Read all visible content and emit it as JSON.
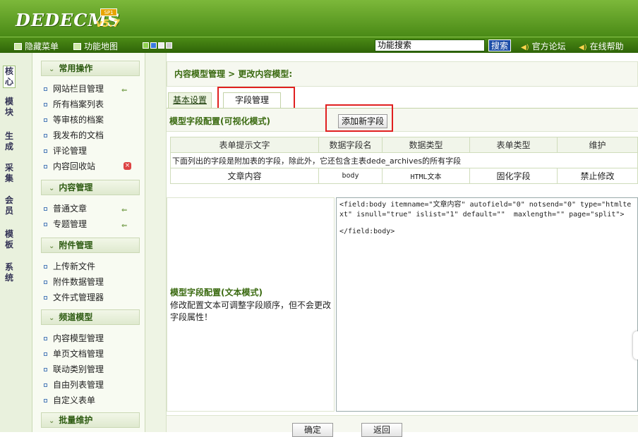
{
  "header": {
    "logo": "DEDECMS",
    "version": "v5.7",
    "badge": "SP1"
  },
  "toolbar": {
    "hide_menu": "隐藏菜单",
    "site_map": "功能地图",
    "search_value": "功能搜索",
    "search_button": "搜索",
    "forum": "官方论坛",
    "help": "在线帮助",
    "swatch_colors": [
      "#8fd14f",
      "#3a7ae0",
      "#eeeeee",
      "#cccccc"
    ]
  },
  "side_tabs": [
    "核心",
    "模块",
    "生成",
    "采集",
    "会员",
    "模板",
    "系统"
  ],
  "menu": {
    "groups": [
      {
        "title": "常用操作",
        "items": [
          "网站栏目管理",
          "所有档案列表",
          "等审核的档案",
          "我发布的文档",
          "评论管理",
          "内容回收站"
        ]
      },
      {
        "title": "内容管理",
        "items": [
          "普通文章",
          "专题管理"
        ]
      },
      {
        "title": "附件管理",
        "items": [
          "上传新文件",
          "附件数据管理",
          "文件式管理器"
        ]
      },
      {
        "title": "频道模型",
        "items": [
          "内容模型管理",
          "单页文档管理",
          "联动类别管理",
          "自由列表管理",
          "自定义表单"
        ]
      },
      {
        "title": "批量维护",
        "items": []
      }
    ]
  },
  "main": {
    "breadcrumb": "内容模型管理 > 更改内容模型:",
    "tabs": [
      "基本设置",
      "字段管理"
    ],
    "config_title": "模型字段配置(可视化模式)",
    "add_field_button": "添加新字段",
    "table": {
      "headers": [
        "表单提示文字",
        "数据字段名",
        "数据类型",
        "表单类型",
        "维护"
      ],
      "note": "下面列出的字段是附加表的字段，除此外，它还包含主表dede_archives的所有字段",
      "rows": [
        [
          "文章内容",
          "body",
          "HTML文本",
          "固化字段",
          "禁止修改"
        ]
      ]
    },
    "text_mode_title": "模型字段配置(文本模式)",
    "text_mode_desc": "修改配置文本可调整字段顺序，但不会更改字段属性！",
    "code_start": "<field:body itemname=\"文章内容\" autofield=\"0\" notsend=\"0\" type=\"htmltext\" isnull=\"true\" islist=\"1\" default=\"\"  maxlength=\"\" page=\"split\">",
    "code_end": "</field:body>",
    "ok_button": "确定",
    "back_button": "返回"
  }
}
